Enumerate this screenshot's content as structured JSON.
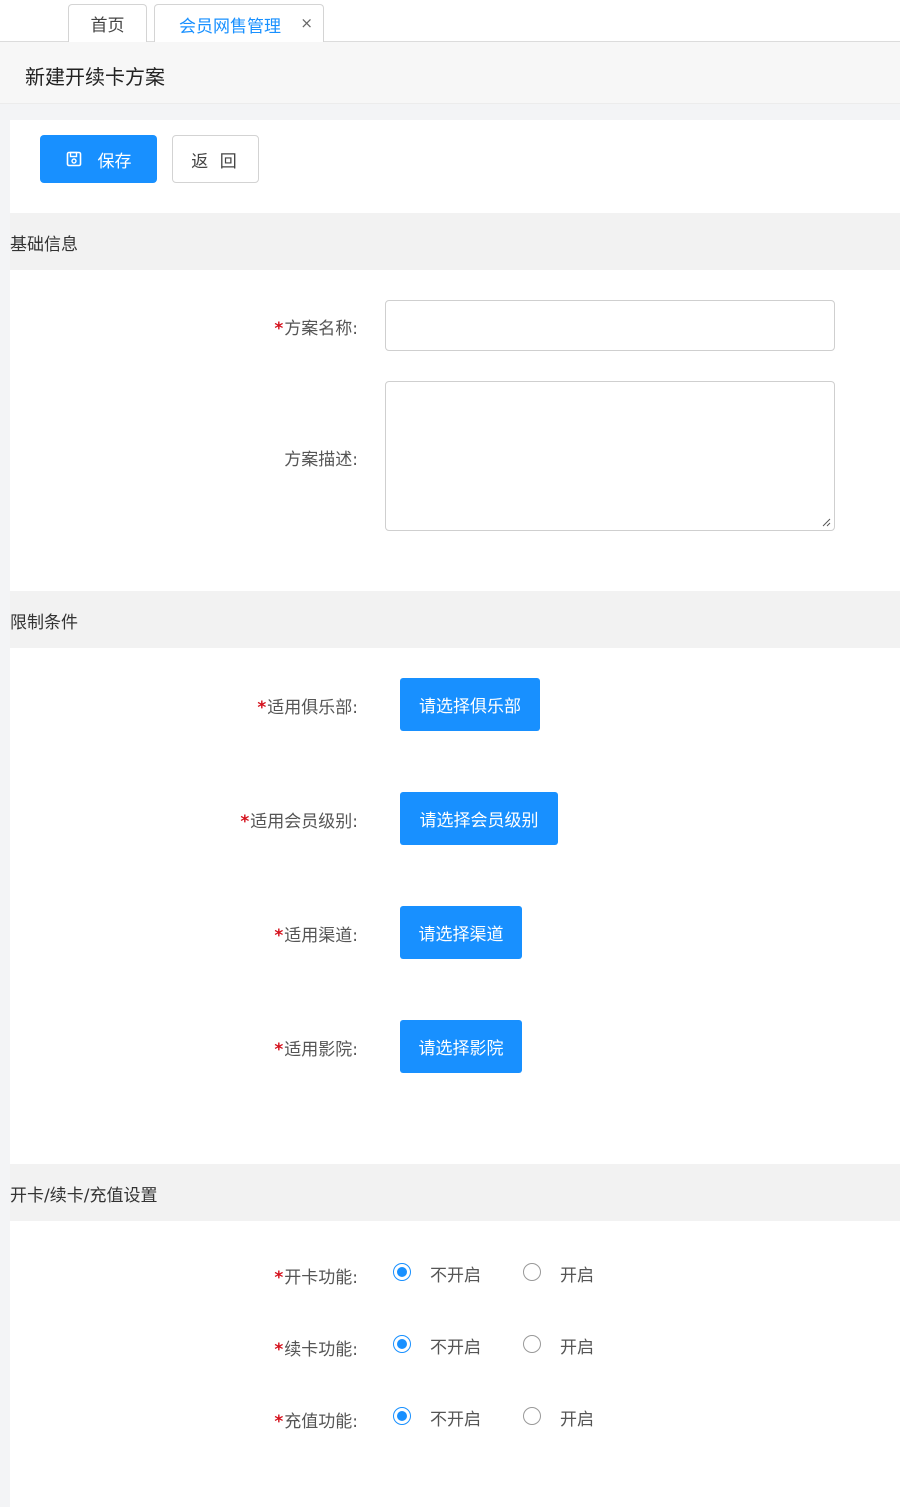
{
  "tabs": [
    {
      "label": "首页"
    },
    {
      "label": "会员网售管理",
      "close": "×"
    }
  ],
  "page": {
    "title": "新建开续卡方案"
  },
  "toolbar": {
    "save_label": "保存",
    "back_label": "返 回"
  },
  "sections": {
    "basic": {
      "title": "基础信息",
      "name_label": "方案名称:",
      "name_value": "",
      "desc_label": "方案描述:",
      "desc_value": ""
    },
    "limits": {
      "title": "限制条件",
      "club_label": "适用俱乐部:",
      "club_button": "请选择俱乐部",
      "level_label": "适用会员级别:",
      "level_button": "请选择会员级别",
      "channel_label": "适用渠道:",
      "channel_button": "请选择渠道",
      "cinema_label": "适用影院:",
      "cinema_button": "请选择影院"
    },
    "settings": {
      "title": "开卡/续卡/充值设置",
      "open_label": "开卡功能:",
      "renew_label": "续卡功能:",
      "recharge_label": "充值功能:",
      "option_off": "不开启",
      "option_on": "开启",
      "open_selected": "不开启",
      "renew_selected": "不开启",
      "recharge_selected": "不开启"
    }
  },
  "required_mark": "*",
  "colors": {
    "primary": "#1890ff",
    "required": "#d4101c"
  }
}
